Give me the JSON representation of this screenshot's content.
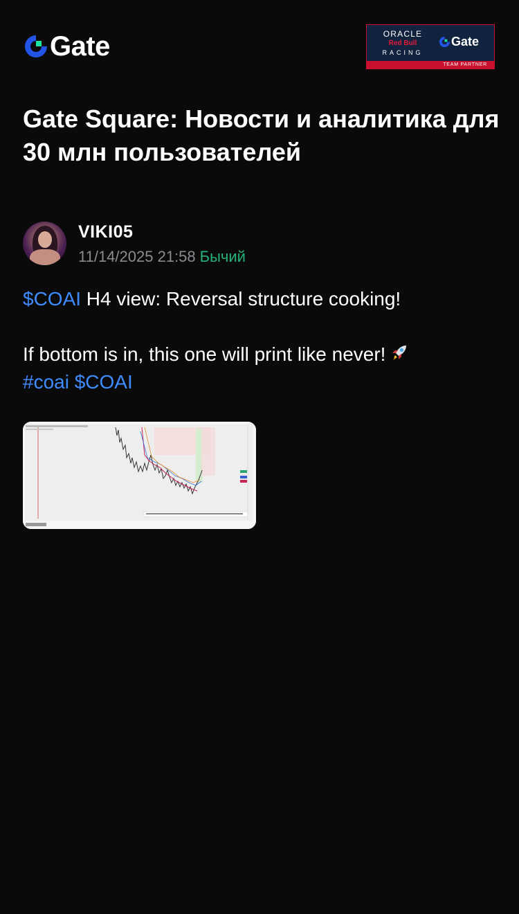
{
  "header": {
    "brand": "Gate",
    "partner": {
      "oracle": "ORACLE",
      "redbull": "Red Bull",
      "racing": "RACING",
      "brand": "Gate",
      "tag": "TEAM PARTNER",
      "border_color": "#c8102e",
      "background": "#11233f"
    },
    "logo_icon": "gate-logo-icon"
  },
  "page": {
    "title": "Gate Square: Новости и аналитика для 30 млн пользователей"
  },
  "post": {
    "author": "VIKI05",
    "date": "11/14/2025 21:58",
    "sentiment": "Бычий",
    "line1_tag": "$COAI",
    "line1_text": " H4 view: Reversal structure cooking!",
    "line2_text": "If bottom is in, this one will print like never!",
    "line2_icon": "rocket-icon",
    "hashtag1": "#coai",
    "hashtag2": "$COAI",
    "image_icon": "chart-screenshot-thumbnail"
  },
  "colors": {
    "background": "#0a0a0b",
    "link": "#3f8cff",
    "bullish": "#25b27a",
    "muted": "#8a8c91"
  }
}
